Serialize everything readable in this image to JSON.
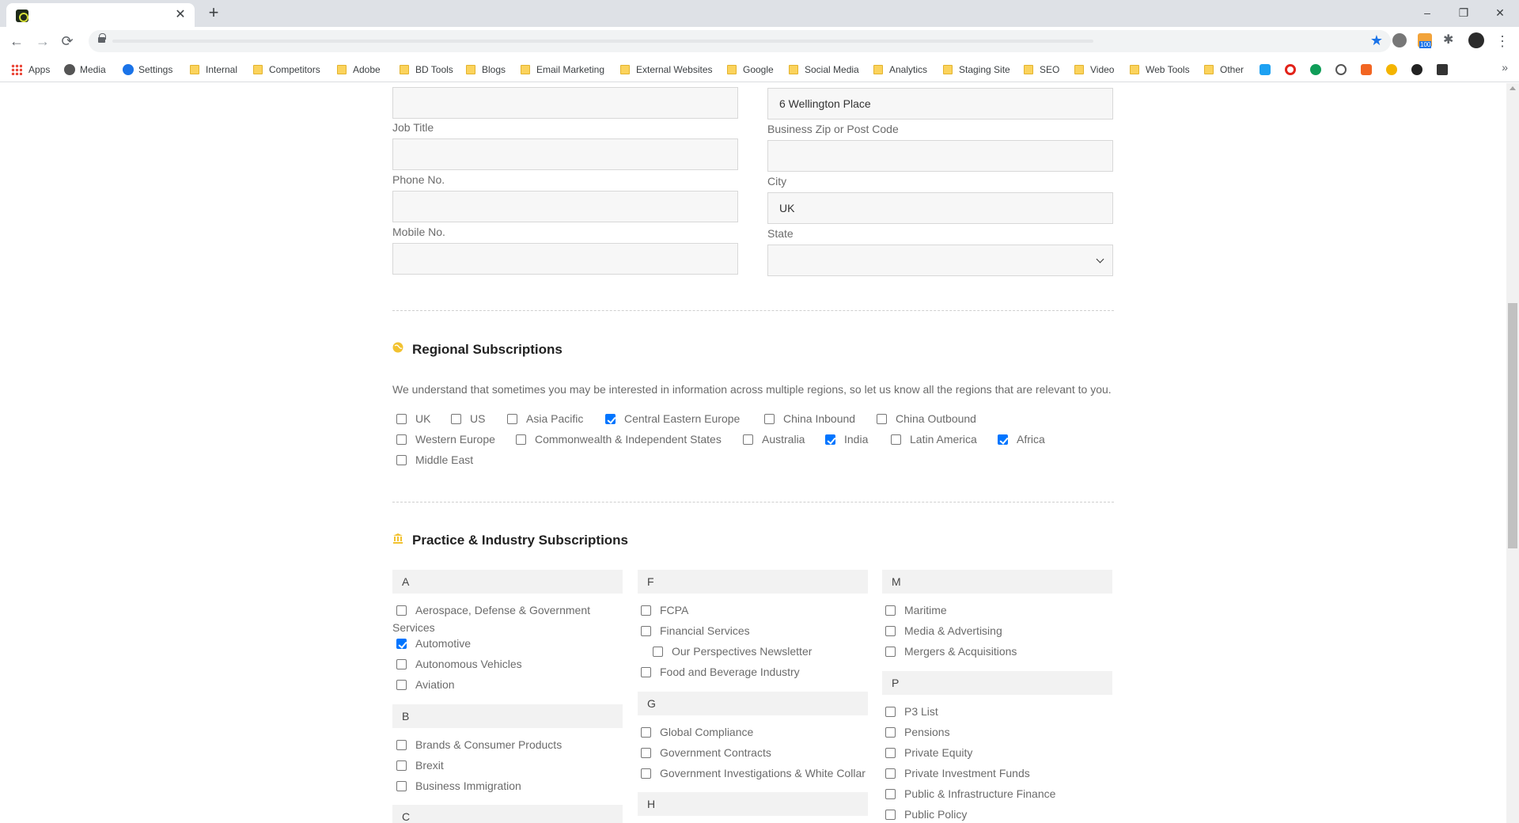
{
  "browser": {
    "new_tab": "+",
    "window_controls": [
      "–",
      "❐",
      "✕"
    ],
    "bookmarks": [
      "Apps",
      "Media",
      "Settings",
      "Internal",
      "Competitors",
      "Adobe",
      "BD Tools",
      "Blogs",
      "Email Marketing",
      "External Websites",
      "Google",
      "Social Media",
      "Analytics",
      "Staging Site",
      "SEO",
      "Video",
      "Web Tools",
      "Other"
    ],
    "more": "»",
    "extension_badge": "100"
  },
  "form": {
    "left_fields": [
      {
        "label": "Job Title",
        "value": ""
      },
      {
        "label": "Phone No.",
        "value": ""
      },
      {
        "label": "Mobile No.",
        "value": ""
      }
    ],
    "top_left_value": "",
    "top_right_value": "6 Wellington Place",
    "right_fields": [
      {
        "label": "Business Zip or Post Code",
        "value": ""
      },
      {
        "label": "City",
        "value": "UK"
      },
      {
        "label": "State",
        "value": ""
      }
    ]
  },
  "regional": {
    "title": "Regional Subscriptions",
    "description": "We understand that sometimes you may be interested in information across multiple regions, so let us know all the regions that are relevant to you.",
    "row1": [
      {
        "label": "UK",
        "checked": false
      },
      {
        "label": "US",
        "checked": false
      },
      {
        "label": "Asia Pacific",
        "checked": false
      },
      {
        "label": "Central Eastern Europe",
        "checked": true
      },
      {
        "label": "China Inbound",
        "checked": false
      },
      {
        "label": "China Outbound",
        "checked": false
      }
    ],
    "row2": [
      {
        "label": "Western Europe",
        "checked": false
      },
      {
        "label": "Commonwealth & Independent States",
        "checked": false
      },
      {
        "label": "Australia",
        "checked": false
      },
      {
        "label": "India",
        "checked": true
      },
      {
        "label": "Latin America",
        "checked": false
      },
      {
        "label": "Africa",
        "checked": true
      }
    ],
    "row3": [
      {
        "label": "Middle East",
        "checked": false
      }
    ]
  },
  "practice": {
    "title": "Practice & Industry Subscriptions",
    "col1": {
      "letterA": "A",
      "a_items": [
        {
          "label": "Aerospace, Defense & Government",
          "label2": "Services",
          "checked": false
        },
        {
          "label": "Automotive",
          "checked": true
        },
        {
          "label": "Autonomous Vehicles",
          "checked": false
        },
        {
          "label": "Aviation",
          "checked": false
        }
      ],
      "letterB": "B",
      "b_items": [
        {
          "label": "Brands & Consumer Products",
          "checked": false
        },
        {
          "label": "Brexit",
          "checked": false
        },
        {
          "label": "Business Immigration",
          "checked": false
        }
      ],
      "letterC": "C"
    },
    "col2": {
      "letterF": "F",
      "f_items": [
        {
          "label": "FCPA",
          "checked": false
        },
        {
          "label": "Financial Services",
          "checked": false
        },
        {
          "label": "Our Perspectives Newsletter",
          "checked": false
        },
        {
          "label": "Food and Beverage Industry",
          "checked": false
        }
      ],
      "letterG": "G",
      "g_items": [
        {
          "label": "Global Compliance",
          "checked": false
        },
        {
          "label": "Government Contracts",
          "checked": false
        },
        {
          "label": "Government Investigations & White Collar",
          "checked": false
        }
      ],
      "letterH": "H"
    },
    "col3": {
      "letterM": "M",
      "m_items": [
        {
          "label": "Maritime",
          "checked": false
        },
        {
          "label": "Media & Advertising",
          "checked": false
        },
        {
          "label": "Mergers & Acquisitions",
          "checked": false
        }
      ],
      "letterP": "P",
      "p_items": [
        {
          "label": "P3 List",
          "checked": false
        },
        {
          "label": "Pensions",
          "checked": false
        },
        {
          "label": "Private Equity",
          "checked": false
        },
        {
          "label": "Private Investment Funds",
          "checked": false
        },
        {
          "label": "Public & Infrastructure Finance",
          "checked": false
        },
        {
          "label": "Public Policy",
          "checked": false
        }
      ]
    }
  },
  "colors": {
    "accent_check": "#0075ff",
    "section_icon": "#f2c230"
  }
}
